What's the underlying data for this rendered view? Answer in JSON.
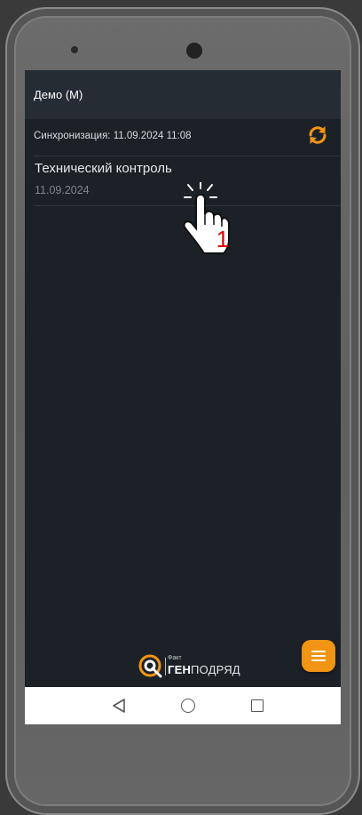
{
  "appbar": {
    "title": "Демо (М)"
  },
  "sync": {
    "label": "Синхронизация: 11.09.2024 11:08",
    "icon": "sync-icon"
  },
  "list": {
    "items": [
      {
        "title": "Технический контроль",
        "date": "11.09.2024"
      }
    ]
  },
  "annotation": {
    "step_number": "1"
  },
  "logo": {
    "small_text": "Факт",
    "brand_bold": "ГЕН",
    "brand_regular": "ПОДРЯД"
  },
  "fab": {
    "icon": "menu-icon"
  },
  "nav": {
    "back_icon": "back-icon",
    "home_icon": "home-icon",
    "recent_icon": "recent-apps-icon"
  },
  "colors": {
    "accent": "#f29414",
    "background": "#1c2128",
    "appbar": "#262c34"
  }
}
